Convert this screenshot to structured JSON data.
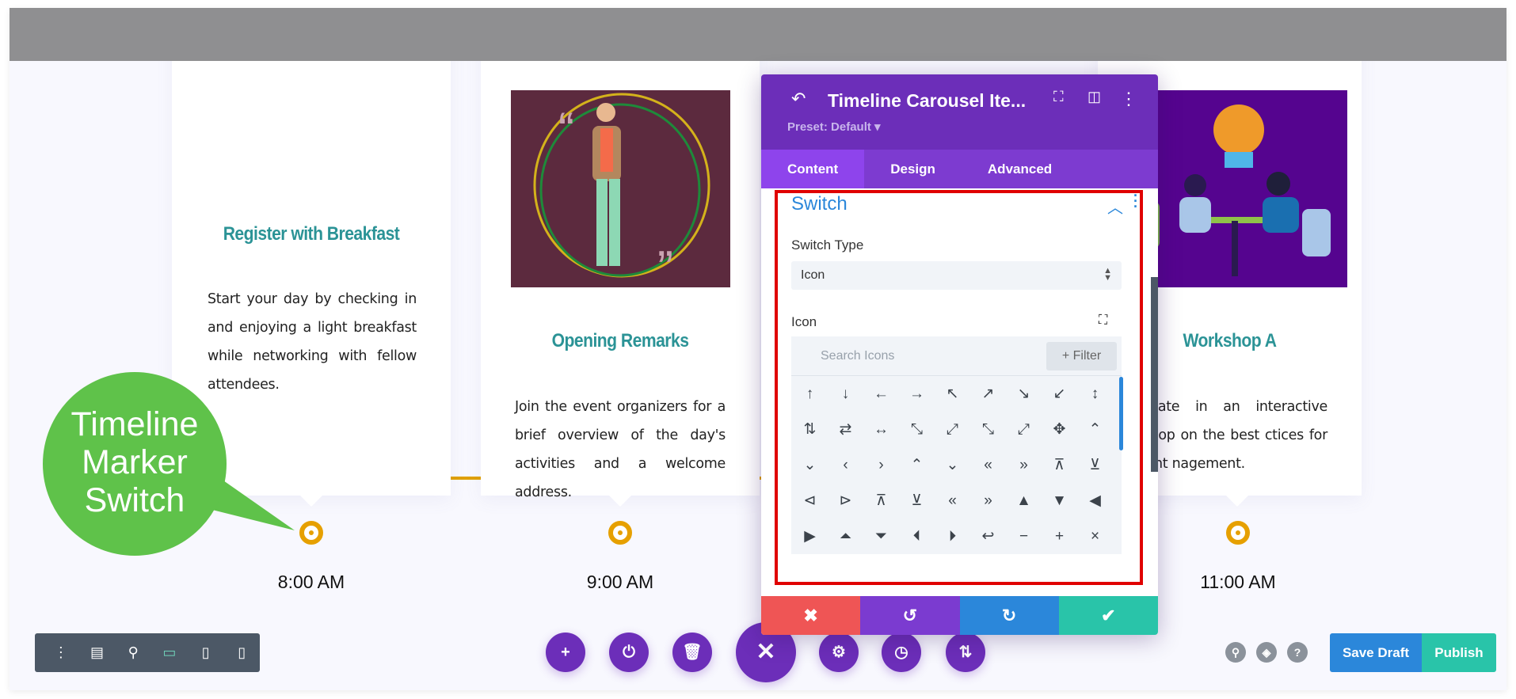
{
  "cards": [
    {
      "title": "Register with Breakfast",
      "body": "Start your day by checking in and enjoying a light breakfast while networking with fellow attendees.",
      "time": "8:00 AM"
    },
    {
      "title": "Opening Remarks",
      "body": "Join the event organizers for a brief overview of the day's activities and a welcome address.",
      "time": "9:00 AM"
    },
    {
      "title": "Workshop A",
      "body": "ticipate in an interactive rkshop on the best ctices for event nagement.",
      "time": "11:00 AM"
    }
  ],
  "callout": {
    "text": "Timeline Marker Switch",
    "color": "#5fc24a"
  },
  "panel": {
    "title": "Timeline Carousel Ite...",
    "preset": "Preset: Default ▾",
    "tabs": [
      "Content",
      "Design",
      "Advanced"
    ],
    "section_title": "Switch",
    "switch_type_label": "Switch Type",
    "switch_type_value": "Icon",
    "icon_label": "Icon",
    "search_placeholder": "Search Icons",
    "filter_label": "+ Filter",
    "icons": [
      "↑",
      "↓",
      "←",
      "→",
      "↖",
      "↗",
      "↘",
      "↙",
      "↕",
      "⇅",
      "⇄",
      "↔",
      "⤡",
      "⤢",
      "⤡",
      "⤢",
      "✥",
      "⌃",
      "⌄",
      "‹",
      "›",
      "⌃",
      "⌄",
      "«",
      "»",
      "⊼",
      "⊻",
      "⊲",
      "⊳",
      "⊼",
      "⊻",
      "«",
      "»",
      "▲",
      "▼",
      "◀",
      "▶",
      "⏶",
      "⏷",
      "⏴",
      "⏵",
      "↩",
      "−",
      "+",
      "×"
    ],
    "colors": {
      "header": "#6c2eb9",
      "cancel": "#ef5555",
      "undo": "#7b3bd0",
      "redo": "#2b87da",
      "save": "#29c4a9"
    }
  },
  "bottom": {
    "save_draft": "Save Draft",
    "publish": "Publish"
  }
}
